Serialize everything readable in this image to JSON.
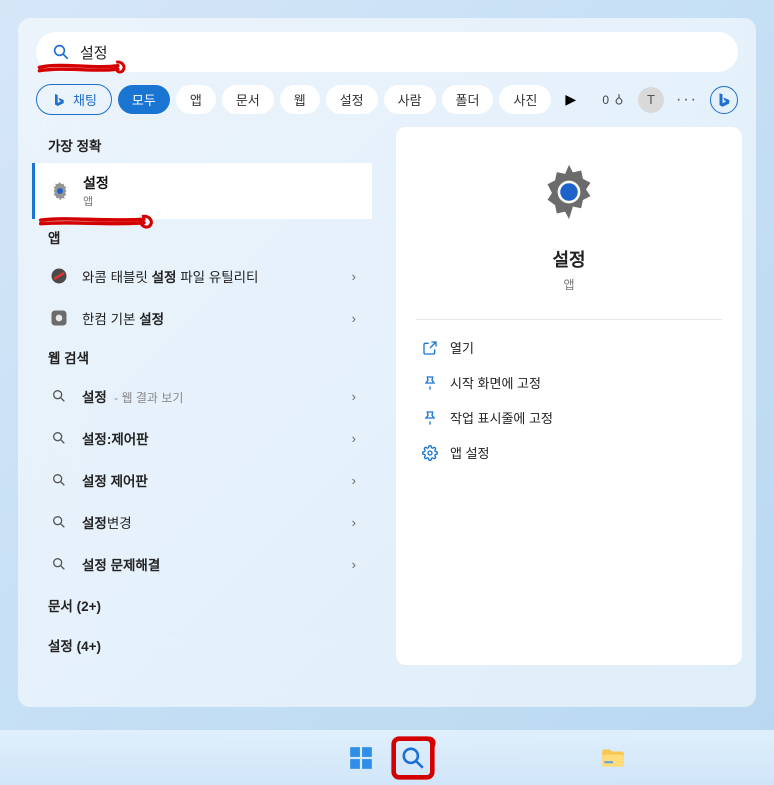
{
  "search": {
    "query": "설정"
  },
  "tabs": {
    "chat": "채팅",
    "all": "모두",
    "apps": "앱",
    "docs": "문서",
    "web": "웹",
    "settings": "설정",
    "people": "사람",
    "folders": "폴더",
    "photos": "사진"
  },
  "points": "0",
  "avatar_initial": "T",
  "best": {
    "heading": "가장 정확",
    "title": "설정",
    "subtitle": "앱"
  },
  "apps": {
    "heading": "앱",
    "items": [
      {
        "label_prefix": "와콤 태블릿 ",
        "label_bold": "설정",
        "label_suffix": " 파일 유틸리티"
      },
      {
        "label_prefix": "한컴 기본 ",
        "label_bold": "설정",
        "label_suffix": ""
      }
    ]
  },
  "websearch": {
    "heading": "웹 검색",
    "items": [
      {
        "p": "",
        "b": "설정",
        "s": "",
        "hint": " - 웹 결과 보기"
      },
      {
        "p": "",
        "b": "설정",
        "s": ":제어판",
        "hint": ""
      },
      {
        "p": "",
        "b": "설정 제어판",
        "s": "",
        "hint": ""
      },
      {
        "p": "",
        "b": "설정",
        "s": "변경",
        "hint": ""
      },
      {
        "p": "",
        "b": "설정 문제해결",
        "s": "",
        "hint": ""
      }
    ]
  },
  "footers": {
    "docs": "문서 (2+)",
    "settings": "설정 (4+)"
  },
  "detail": {
    "title": "설정",
    "subtitle": "앱",
    "actions": {
      "open": "열기",
      "pin_start": "시작 화면에 고정",
      "pin_taskbar": "작업 표시줄에 고정",
      "app_settings": "앱 설정"
    }
  }
}
